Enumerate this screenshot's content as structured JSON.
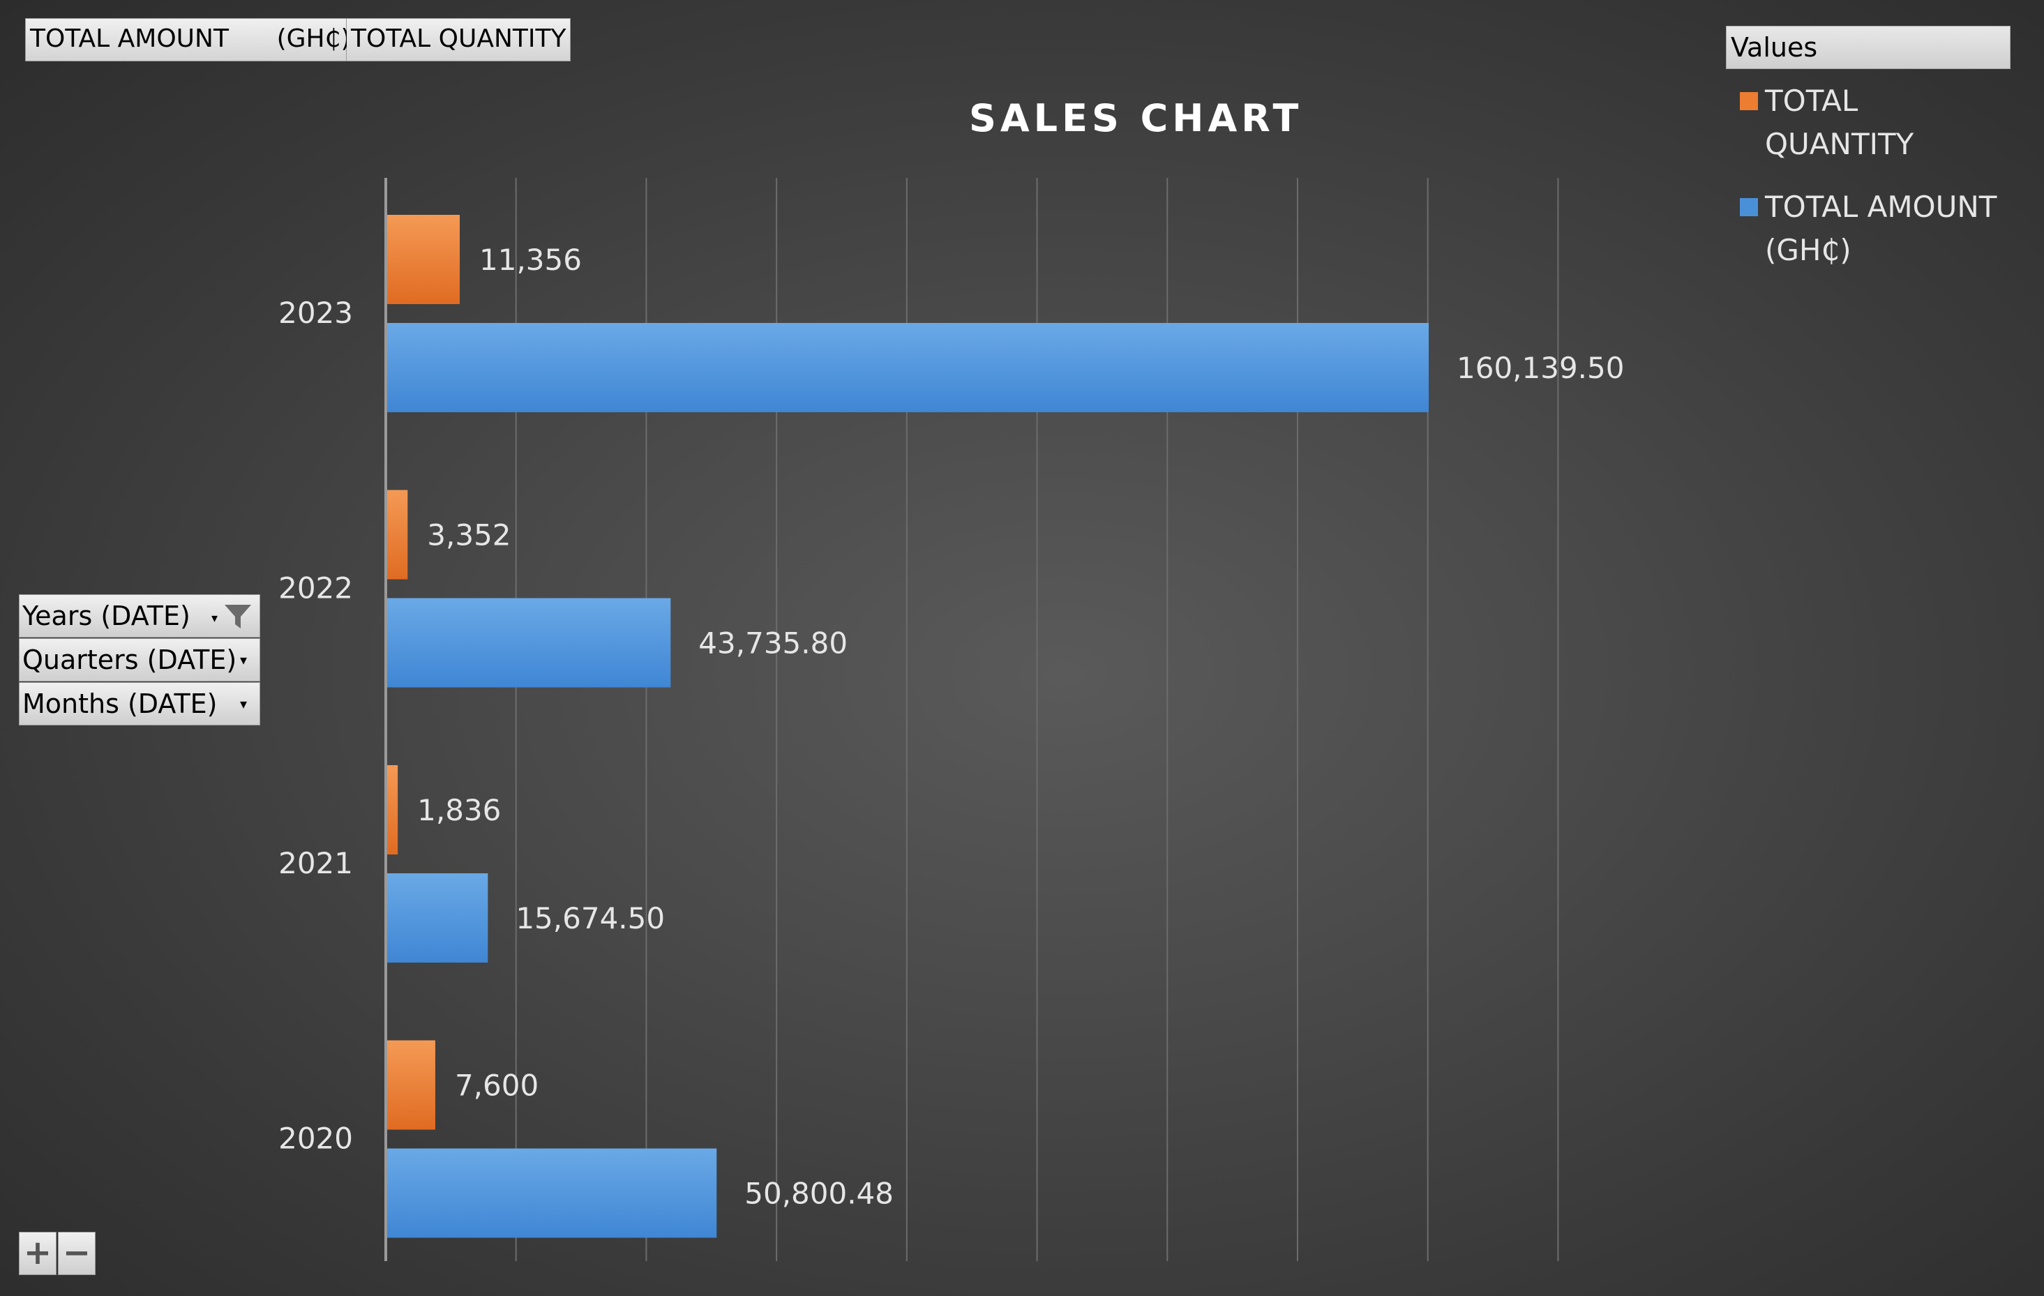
{
  "value_fields": [
    {
      "label": "TOTAL AMOUNT      (GH₵)"
    },
    {
      "label": "TOTAL QUANTITY"
    }
  ],
  "legend": {
    "header": "Values",
    "items": [
      {
        "line1": "TOTAL",
        "line2": "QUANTITY",
        "color": "#ed7d31"
      },
      {
        "line1": "TOTAL AMOUNT",
        "line2": "(GH₵)",
        "color": "#4a90d9"
      }
    ]
  },
  "axis_fields": [
    {
      "label": "Years (DATE)",
      "icon": "filter-icon"
    },
    {
      "label": "Quarters (DATE)",
      "icon": "dropdown-icon"
    },
    {
      "label": "Months (DATE)",
      "icon": "dropdown-icon"
    }
  ],
  "zoom": {
    "expand": "+",
    "collapse": "−"
  },
  "chart_data": {
    "type": "bar",
    "orientation": "horizontal",
    "title": "SALES CHART",
    "categories": [
      "2023",
      "2022",
      "2021",
      "2020"
    ],
    "series": [
      {
        "name": "TOTAL QUANTITY",
        "color": "#ed7d31",
        "values": [
          11356,
          3352,
          1836,
          7600
        ],
        "labels": [
          "11,356",
          "3,352",
          "1,836",
          "7,600"
        ]
      },
      {
        "name": "TOTAL AMOUNT (GH₵)",
        "color": "#4a90d9",
        "values": [
          160139.5,
          43735.8,
          15674.5,
          50800.48
        ],
        "labels": [
          "160,139.50",
          "43,735.80",
          "15,674.50",
          "50,800.48"
        ]
      }
    ],
    "xlim": [
      0,
      180000
    ],
    "grid": true,
    "legend_position": "top-right"
  }
}
